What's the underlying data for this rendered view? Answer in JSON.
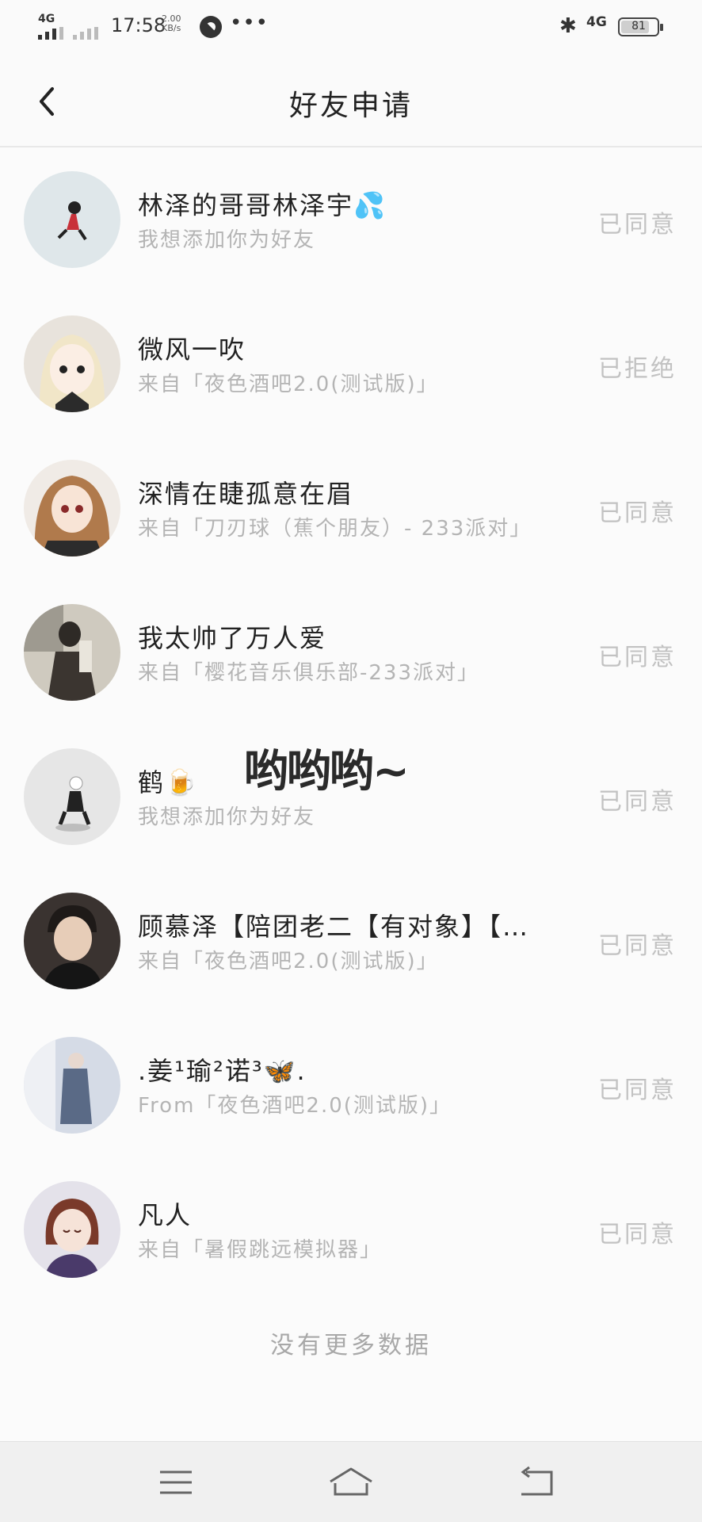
{
  "status_bar": {
    "network": "4G",
    "time": "17:58",
    "speed_value": "2.00",
    "speed_unit": "KB/s",
    "dots": "•••",
    "network_right": "4G",
    "battery_level": "81"
  },
  "header": {
    "title": "好友申请"
  },
  "requests": [
    {
      "name": "林泽的哥哥林泽宇💦",
      "sub": "我想添加你为好友",
      "status": "已同意"
    },
    {
      "name": "微风一吹",
      "sub": "来自「夜色酒吧2.0(测试版)」",
      "status": "已拒绝"
    },
    {
      "name": "深情在睫孤意在眉",
      "sub": "来自「刀刃球（蕉个朋友）- 233派对」",
      "status": "已同意"
    },
    {
      "name": "我太帅了万人爱",
      "sub": "来自「樱花音乐俱乐部-233派对」",
      "status": "已同意"
    },
    {
      "name": "鹤🍺",
      "sub": "我想添加你为好友",
      "status": "已同意"
    },
    {
      "name": "顾慕泽【陪团老二【有对象】【…",
      "sub": "来自「夜色酒吧2.0(测试版)」",
      "status": "已同意"
    },
    {
      "name": ".姜¹瑜²诺³🦋.",
      "sub": "From「夜色酒吧2.0(测试版)」",
      "status": "已同意"
    },
    {
      "name": "凡人",
      "sub": "来自「暑假跳远模拟器」",
      "status": "已同意"
    }
  ],
  "overlay_text": "哟哟哟~",
  "footer_note": "没有更多数据",
  "icons": {
    "back": "chevron-left-icon",
    "menu": "menu-icon",
    "home": "home-icon",
    "return": "return-icon"
  },
  "colors": {
    "background": "#fbfbfb",
    "text_primary": "#222222",
    "text_secondary": "#b4b4b4",
    "status_text": "#c2c2c2"
  }
}
